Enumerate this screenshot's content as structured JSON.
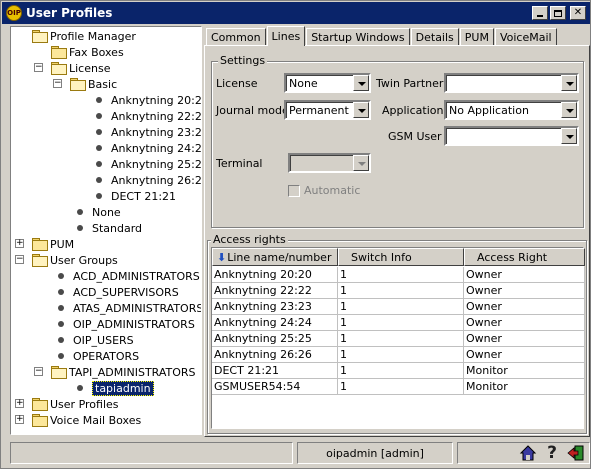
{
  "window": {
    "title": "User Profiles",
    "app_icon_text": "OIP"
  },
  "tree": {
    "items": [
      {
        "label": "Profile Manager",
        "kind": "folder-open",
        "level": 0
      },
      {
        "label": "Fax Boxes",
        "kind": "folder",
        "level": 1
      },
      {
        "label": "License",
        "kind": "folder-open",
        "level": 1
      },
      {
        "label": "Basic",
        "kind": "folder-open",
        "level": 2
      },
      {
        "label": "Anknytning 20:20",
        "kind": "leaf",
        "level": 3
      },
      {
        "label": "Anknytning 22:22",
        "kind": "leaf",
        "level": 3
      },
      {
        "label": "Anknytning 23:23",
        "kind": "leaf",
        "level": 3
      },
      {
        "label": "Anknytning 24:24",
        "kind": "leaf",
        "level": 3
      },
      {
        "label": "Anknytning 25:25",
        "kind": "leaf",
        "level": 3
      },
      {
        "label": "Anknytning 26:26",
        "kind": "leaf",
        "level": 3
      },
      {
        "label": "DECT 21:21",
        "kind": "leaf",
        "level": 3
      },
      {
        "label": "None",
        "kind": "leaf",
        "level": 2
      },
      {
        "label": "Standard",
        "kind": "leaf",
        "level": 2
      },
      {
        "label": "PUM",
        "kind": "folder",
        "level": 0
      },
      {
        "label": "User Groups",
        "kind": "folder-open",
        "level": 0
      },
      {
        "label": "ACD_ADMINISTRATORS",
        "kind": "leaf",
        "level": 1
      },
      {
        "label": "ACD_SUPERVISORS",
        "kind": "leaf",
        "level": 1
      },
      {
        "label": "ATAS_ADMINISTRATORS",
        "kind": "leaf",
        "level": 1
      },
      {
        "label": "OIP_ADMINISTRATORS",
        "kind": "leaf",
        "level": 1
      },
      {
        "label": "OIP_USERS",
        "kind": "leaf",
        "level": 1
      },
      {
        "label": "OPERATORS",
        "kind": "leaf",
        "level": 1
      },
      {
        "label": "TAPI_ADMINISTRATORS",
        "kind": "folder-open",
        "level": 1
      },
      {
        "label": "tapiadmin",
        "kind": "leaf",
        "level": 2,
        "selected": true
      },
      {
        "label": "User Profiles",
        "kind": "folder",
        "level": 0
      },
      {
        "label": "Voice Mail Boxes",
        "kind": "folder",
        "level": 0
      }
    ]
  },
  "tabs": [
    "Common",
    "Lines",
    "Startup Windows",
    "Details",
    "PUM",
    "VoiceMail"
  ],
  "active_tab": "Lines",
  "settings": {
    "title": "Settings",
    "license_label": "License",
    "license_value": "None",
    "twin_partner_label": "Twin Partner",
    "twin_partner_value": "",
    "journal_mode_label": "Journal mode",
    "journal_mode_value": "Permanent",
    "application_label": "Application",
    "application_value": "No Application",
    "gsm_user_label": "GSM User",
    "gsm_user_value": "",
    "terminal_label": "Terminal",
    "terminal_value": "",
    "automatic_label": "Automatic"
  },
  "access_rights": {
    "title": "Access rights",
    "columns": [
      "Line name/number",
      "Switch Info",
      "Access Right"
    ],
    "rows": [
      [
        "Anknytning 20:20",
        "1",
        "Owner"
      ],
      [
        "Anknytning 22:22",
        "1",
        "Owner"
      ],
      [
        "Anknytning 23:23",
        "1",
        "Owner"
      ],
      [
        "Anknytning 24:24",
        "1",
        "Owner"
      ],
      [
        "Anknytning 25:25",
        "1",
        "Owner"
      ],
      [
        "Anknytning 26:26",
        "1",
        "Owner"
      ],
      [
        "DECT 21:21",
        "1",
        "Monitor"
      ],
      [
        "GSMUSER54:54",
        "1",
        "Monitor"
      ]
    ]
  },
  "statusbar": {
    "user": "oipadmin [admin]"
  },
  "colors": {
    "titlebar": "#0a246a",
    "face": "#d4d0c8",
    "selection": "#0a246a"
  }
}
